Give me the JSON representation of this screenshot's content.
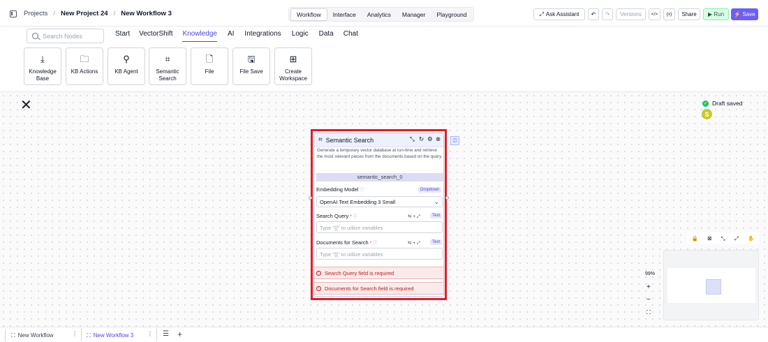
{
  "breadcrumb": {
    "root": "Projects",
    "project": "New Project 24",
    "workflow": "New Workflow 3"
  },
  "top_tabs": [
    {
      "label": "Workflow",
      "active": true
    },
    {
      "label": "Interface"
    },
    {
      "label": "Analytics"
    },
    {
      "label": "Manager"
    },
    {
      "label": "Playground"
    }
  ],
  "toolbar": {
    "ask_label": "Ask Assistant",
    "undo_icon": "↶",
    "redo_icon": "↷",
    "versions_label": "Versions",
    "code_icon": "</>",
    "vars_icon": "{x}",
    "share_label": "Share",
    "run_label": "▶ Run",
    "save_label": "⚡ Save"
  },
  "search": {
    "placeholder": "Search Nodes"
  },
  "categories": [
    "Start",
    "VectorShift",
    "Knowledge",
    "AI",
    "Integrations",
    "Logic",
    "Data",
    "Chat"
  ],
  "active_category": "Knowledge",
  "tiles": [
    {
      "icon": "⤓",
      "label": "Knowledge Base"
    },
    {
      "icon": "🗀",
      "label": "KB Actions"
    },
    {
      "icon": "⚲",
      "label": "KB Agent"
    },
    {
      "icon": "⌗",
      "label": "Semantic Search"
    },
    {
      "icon": "🗋",
      "label": "File"
    },
    {
      "icon": "🖫",
      "label": "File Save"
    },
    {
      "icon": "⊞",
      "label": "Create Workspace"
    }
  ],
  "canvas": {
    "close_icon": "✕",
    "draft_status": "Draft saved",
    "avatar_letter": "S",
    "zoom": "99%",
    "zoom_in": "+",
    "zoom_out": "−",
    "fit": "⛶"
  },
  "node": {
    "title": "Semantic Search",
    "description": "Generate a temporary vector database at run-time and retrieve the most relevant pieces from the documents based on the query.",
    "name": "semantic_search_0",
    "embedding_label": "Embedding Model",
    "embedding_badge": "Dropdown",
    "embedding_value": "OpenAI Text Embedding 3 Small",
    "query_label": "Search Query",
    "query_badge": "Text",
    "query_placeholder": "Type \"{{\" to utilize variables",
    "docs_label": "Documents for Search",
    "docs_badge": "Text",
    "docs_placeholder": "Type \"{{\" to utilize variables",
    "error_query": "Search Query field is required",
    "error_docs": "Documents for Search field is required"
  },
  "bottom_tabs": [
    {
      "label": "New Workflow",
      "active": false
    },
    {
      "label": "New Workflow 3",
      "active": true
    }
  ],
  "colors": {
    "accent": "#4f46e5",
    "error": "#e11d27",
    "run": "#dcfce7",
    "save": "#6d5dfc"
  }
}
